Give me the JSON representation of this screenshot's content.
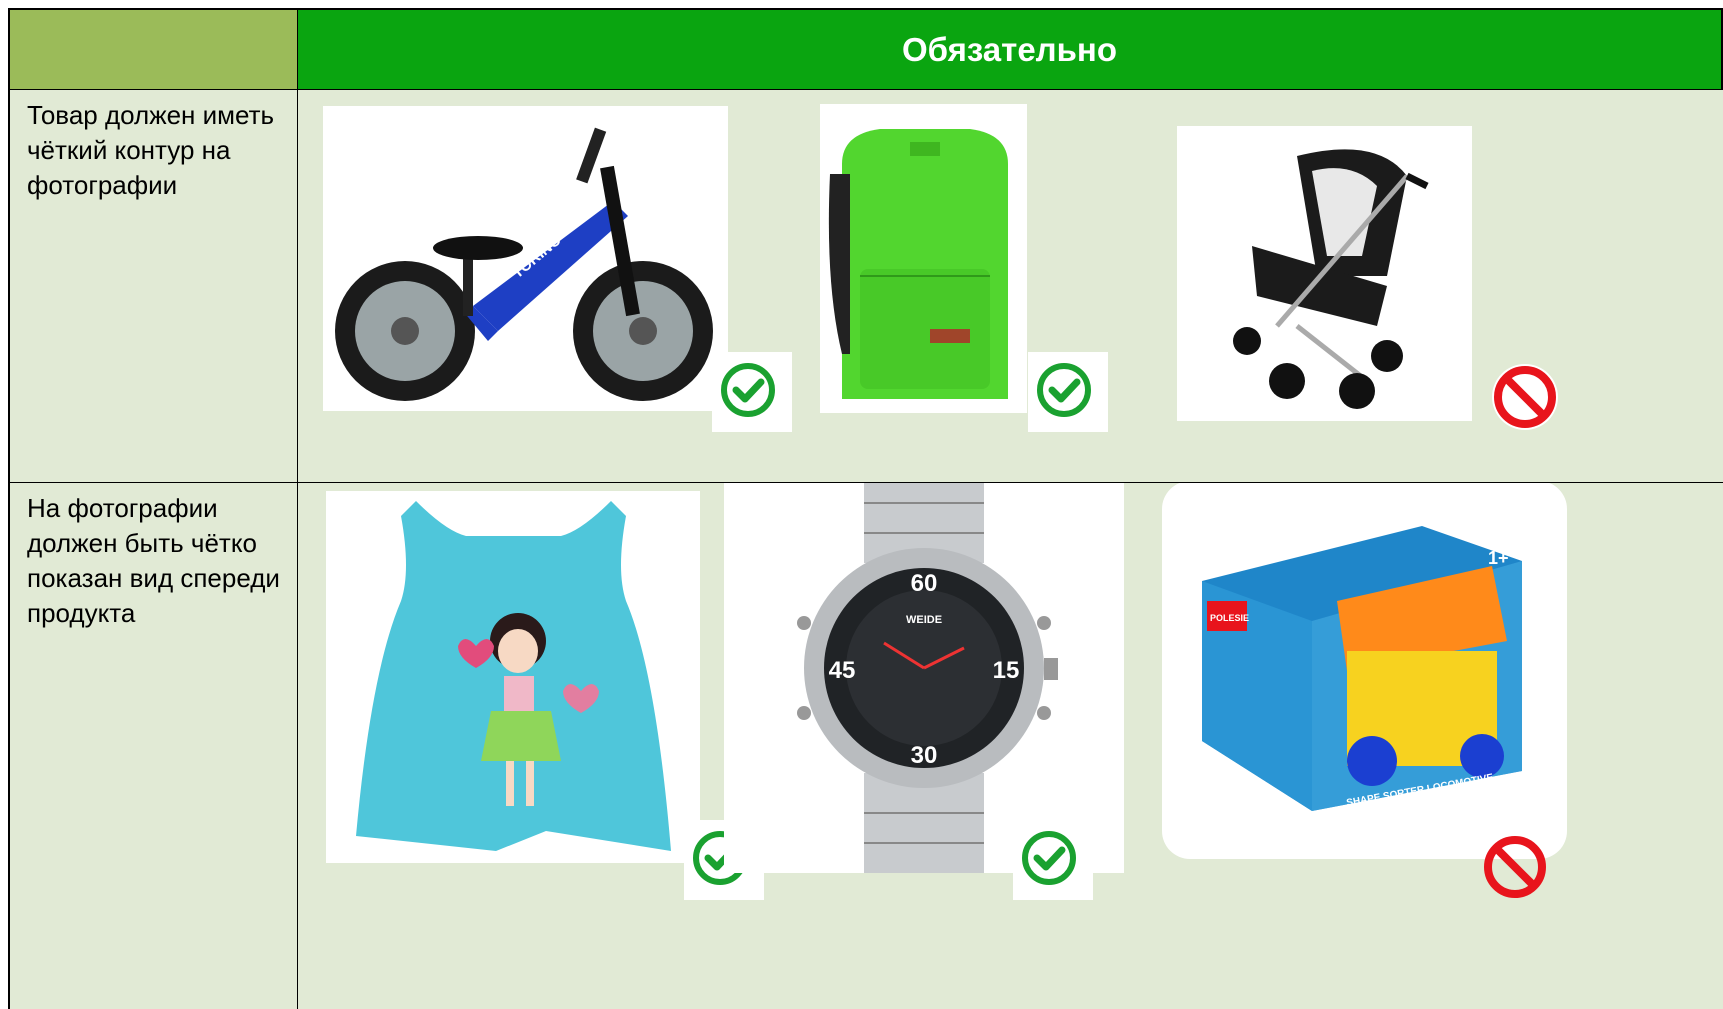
{
  "header": {
    "title": "Обязательно"
  },
  "rows": [
    {
      "label": "Товар должен иметь чёткий контур на фотографии",
      "items": [
        {
          "name": "balance-bike",
          "brand_text": "TORINO",
          "verdict": "ok"
        },
        {
          "name": "green-backpack",
          "verdict": "ok"
        },
        {
          "name": "baby-stroller",
          "verdict": "bad"
        }
      ]
    },
    {
      "label": "На фотографии должен быть чётко показан вид спереди продукта",
      "items": [
        {
          "name": "kids-tank-top",
          "verdict": "ok"
        },
        {
          "name": "wrist-watch",
          "watch_brand": "WEIDE",
          "verdict": "ok"
        },
        {
          "name": "toy-box",
          "toy_title": "SHAPE SORTER LOCOMOTIVE",
          "toy_brand": "POLESIE",
          "toy_age": "1+",
          "verdict": "bad"
        }
      ]
    }
  ],
  "colors": {
    "header_green": "#0aa510",
    "header_left": "#9bbb59",
    "row_bg": "#e1ead5",
    "ok": "#1aa130",
    "bad": "#e8141c"
  }
}
